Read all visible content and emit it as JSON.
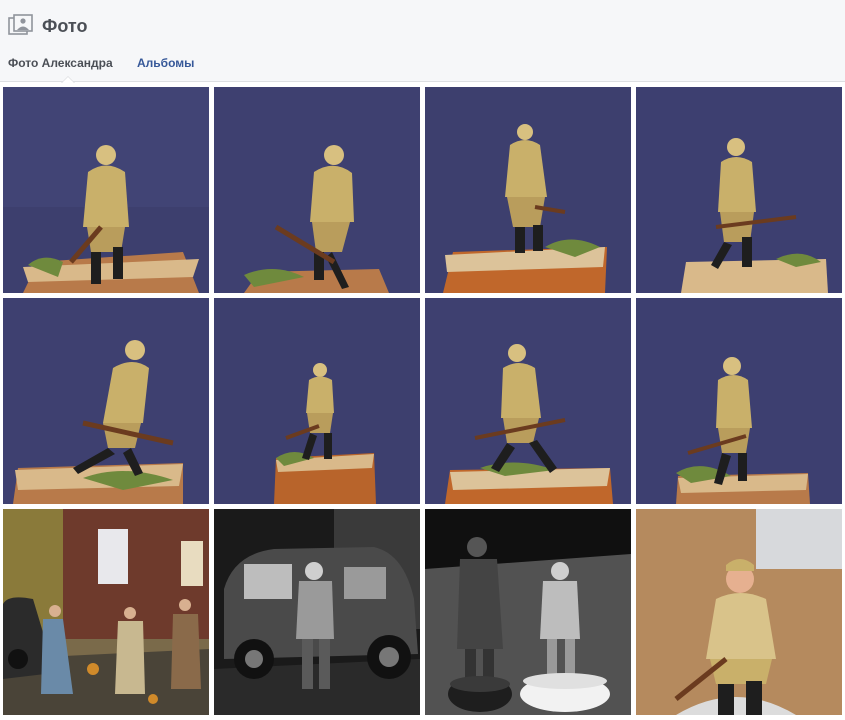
{
  "header": {
    "title": "Фото",
    "icon": "photo-icon"
  },
  "tabs": [
    {
      "label": "Фото Александра",
      "active": true
    },
    {
      "label": "Альбомы",
      "active": false
    }
  ],
  "colors": {
    "link": "#365899",
    "header_bg": "#f6f7f9",
    "border": "#dddfe2"
  },
  "photos": [
    {
      "scene": "soldier-figure-blue-backdrop"
    },
    {
      "scene": "soldier-figure-blue-backdrop"
    },
    {
      "scene": "soldier-figure-blue-backdrop"
    },
    {
      "scene": "soldier-figure-blue-backdrop"
    },
    {
      "scene": "soldier-figure-blue-backdrop"
    },
    {
      "scene": "soldier-figure-blue-backdrop"
    },
    {
      "scene": "soldier-figure-blue-backdrop"
    },
    {
      "scene": "soldier-figure-blue-backdrop"
    },
    {
      "scene": "street-diorama-car-figures"
    },
    {
      "scene": "grey-primed-car-figure"
    },
    {
      "scene": "grey-primed-figures-on-wheels"
    },
    {
      "scene": "painted-soldier-on-table"
    }
  ]
}
